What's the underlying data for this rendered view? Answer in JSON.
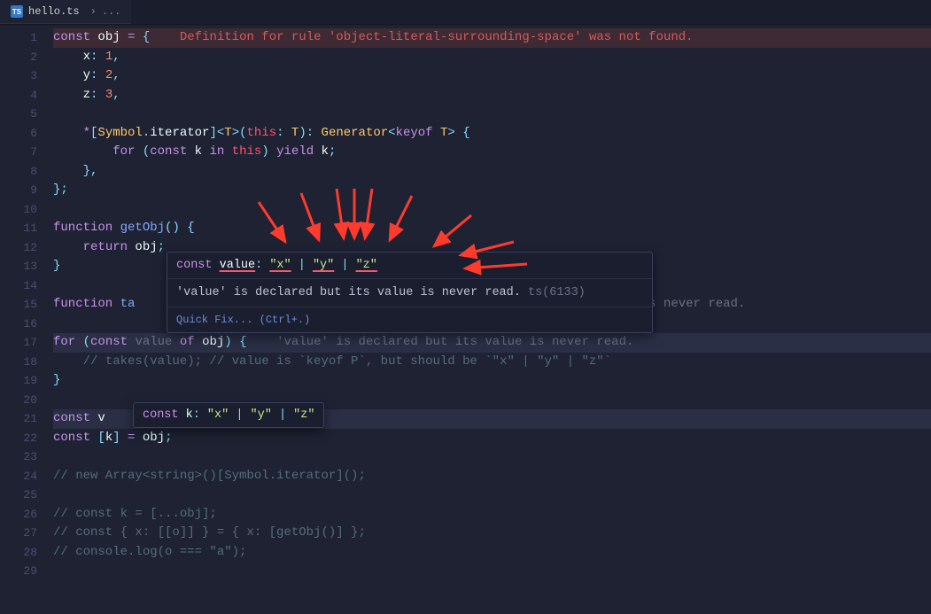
{
  "tab": {
    "label": "hello.ts",
    "icon": "TS",
    "breadcrumb_sep": "›",
    "breadcrumb_more": "..."
  },
  "lines": [
    {
      "n": 1,
      "segs": [
        {
          "t": "const ",
          "c": "kw-purple"
        },
        {
          "t": "obj",
          "c": "var"
        },
        {
          "t": " ",
          "c": ""
        },
        {
          "t": "=",
          "c": "kw-purple"
        },
        {
          "t": " ",
          "c": ""
        },
        {
          "t": "{",
          "c": "punct"
        },
        {
          "t": "    ",
          "c": ""
        },
        {
          "t": "Definition for rule 'object-literal-surrounding-space' was not found.",
          "c": "inline-err"
        }
      ],
      "hl": "err"
    },
    {
      "n": 2,
      "segs": [
        {
          "t": "    x",
          "c": "var"
        },
        {
          "t": ":",
          "c": "punct"
        },
        {
          "t": " ",
          "c": ""
        },
        {
          "t": "1",
          "c": "num"
        },
        {
          "t": ",",
          "c": "punct"
        }
      ]
    },
    {
      "n": 3,
      "segs": [
        {
          "t": "    y",
          "c": "var"
        },
        {
          "t": ":",
          "c": "punct"
        },
        {
          "t": " ",
          "c": ""
        },
        {
          "t": "2",
          "c": "num"
        },
        {
          "t": ",",
          "c": "punct"
        }
      ]
    },
    {
      "n": 4,
      "segs": [
        {
          "t": "    z",
          "c": "var"
        },
        {
          "t": ":",
          "c": "punct"
        },
        {
          "t": " ",
          "c": ""
        },
        {
          "t": "3",
          "c": "num"
        },
        {
          "t": ",",
          "c": "punct"
        }
      ]
    },
    {
      "n": 5,
      "segs": []
    },
    {
      "n": 6,
      "segs": [
        {
          "t": "    ",
          "c": ""
        },
        {
          "t": "*",
          "c": "kw-purple"
        },
        {
          "t": "[",
          "c": "punct"
        },
        {
          "t": "Symbol",
          "c": "fn-yellow"
        },
        {
          "t": ".",
          "c": "punct"
        },
        {
          "t": "iterator",
          "c": "var"
        },
        {
          "t": "]",
          "c": "punct"
        },
        {
          "t": "<",
          "c": "punct"
        },
        {
          "t": "T",
          "c": "fn-yellow"
        },
        {
          "t": ">",
          "c": "punct"
        },
        {
          "t": "(",
          "c": "punct"
        },
        {
          "t": "this",
          "c": "kw-red"
        },
        {
          "t": ":",
          "c": "punct"
        },
        {
          "t": " ",
          "c": ""
        },
        {
          "t": "T",
          "c": "fn-yellow"
        },
        {
          "t": ")",
          "c": "punct"
        },
        {
          "t": ":",
          "c": "punct"
        },
        {
          "t": " ",
          "c": ""
        },
        {
          "t": "Generator",
          "c": "fn-yellow"
        },
        {
          "t": "<",
          "c": "punct"
        },
        {
          "t": "keyof ",
          "c": "kw-purple"
        },
        {
          "t": "T",
          "c": "fn-yellow"
        },
        {
          "t": ">",
          "c": "punct"
        },
        {
          "t": " ",
          "c": ""
        },
        {
          "t": "{",
          "c": "punct"
        }
      ]
    },
    {
      "n": 7,
      "segs": [
        {
          "t": "        ",
          "c": ""
        },
        {
          "t": "for ",
          "c": "kw-purple"
        },
        {
          "t": "(",
          "c": "punct"
        },
        {
          "t": "const ",
          "c": "kw-purple"
        },
        {
          "t": "k",
          "c": "var"
        },
        {
          "t": " ",
          "c": ""
        },
        {
          "t": "in ",
          "c": "kw-purple"
        },
        {
          "t": "this",
          "c": "kw-red"
        },
        {
          "t": ")",
          "c": "punct"
        },
        {
          "t": " ",
          "c": ""
        },
        {
          "t": "yield ",
          "c": "kw-purple"
        },
        {
          "t": "k",
          "c": "var"
        },
        {
          "t": ";",
          "c": "punct"
        }
      ]
    },
    {
      "n": 8,
      "segs": [
        {
          "t": "    ",
          "c": ""
        },
        {
          "t": "},",
          "c": "punct"
        }
      ]
    },
    {
      "n": 9,
      "segs": [
        {
          "t": "};",
          "c": "punct"
        }
      ]
    },
    {
      "n": 10,
      "segs": []
    },
    {
      "n": 11,
      "segs": [
        {
          "t": "function ",
          "c": "kw-purple"
        },
        {
          "t": "getObj",
          "c": "fn-blue"
        },
        {
          "t": "()",
          "c": "punct"
        },
        {
          "t": " ",
          "c": ""
        },
        {
          "t": "{",
          "c": "punct"
        }
      ]
    },
    {
      "n": 12,
      "segs": [
        {
          "t": "    ",
          "c": ""
        },
        {
          "t": "return ",
          "c": "kw-purple"
        },
        {
          "t": "obj",
          "c": "var"
        },
        {
          "t": ";",
          "c": "punct"
        }
      ]
    },
    {
      "n": 13,
      "segs": [
        {
          "t": "}",
          "c": "punct"
        }
      ]
    },
    {
      "n": 14,
      "segs": []
    },
    {
      "n": 15,
      "segs": [
        {
          "t": "function ",
          "c": "kw-purple"
        },
        {
          "t": "ta",
          "c": "fn-blue"
        },
        {
          "t": "                                                                    ",
          "c": ""
        },
        {
          "t": "is never read.",
          "c": "faded"
        }
      ]
    },
    {
      "n": 16,
      "segs": []
    },
    {
      "n": 17,
      "segs": [
        {
          "t": "for ",
          "c": "kw-purple"
        },
        {
          "t": "(",
          "c": "punct"
        },
        {
          "t": "const ",
          "c": "kw-purple"
        },
        {
          "t": "value",
          "c": "faded"
        },
        {
          "t": " ",
          "c": ""
        },
        {
          "t": "of ",
          "c": "kw-purple"
        },
        {
          "t": "obj",
          "c": "var"
        },
        {
          "t": ")",
          "c": "punct"
        },
        {
          "t": " ",
          "c": ""
        },
        {
          "t": "{",
          "c": "punct"
        },
        {
          "t": "    ",
          "c": ""
        },
        {
          "t": "'value' is declared but its value is never read.",
          "c": "faded"
        }
      ],
      "hl": "hl"
    },
    {
      "n": 18,
      "segs": [
        {
          "t": "    ",
          "c": ""
        },
        {
          "t": "// takes(value); // value is `keyof P`, but should be `\"x\" | \"y\" | \"z\"`",
          "c": "comment"
        }
      ]
    },
    {
      "n": 19,
      "segs": [
        {
          "t": "}",
          "c": "punct"
        }
      ]
    },
    {
      "n": 20,
      "segs": []
    },
    {
      "n": 21,
      "segs": [
        {
          "t": "const ",
          "c": "kw-purple"
        },
        {
          "t": "v",
          "c": "var"
        }
      ],
      "hl": "hl"
    },
    {
      "n": 22,
      "segs": [
        {
          "t": "const ",
          "c": "kw-purple"
        },
        {
          "t": "[",
          "c": "punct"
        },
        {
          "t": "k",
          "c": "var"
        },
        {
          "t": "]",
          "c": "punct"
        },
        {
          "t": " ",
          "c": ""
        },
        {
          "t": "=",
          "c": "kw-purple"
        },
        {
          "t": " ",
          "c": ""
        },
        {
          "t": "obj",
          "c": "var"
        },
        {
          "t": ";",
          "c": "punct"
        }
      ]
    },
    {
      "n": 23,
      "segs": []
    },
    {
      "n": 24,
      "segs": [
        {
          "t": "// new Array<string>()[Symbol.iterator]();",
          "c": "comment"
        }
      ]
    },
    {
      "n": 25,
      "segs": []
    },
    {
      "n": 26,
      "segs": [
        {
          "t": "// const k = [...obj];",
          "c": "comment"
        }
      ]
    },
    {
      "n": 27,
      "segs": [
        {
          "t": "// const { x: [[o]] } = { x: [getObj()] };",
          "c": "comment"
        }
      ]
    },
    {
      "n": 28,
      "segs": [
        {
          "t": "// console.log(o === \"a\");",
          "c": "comment"
        }
      ]
    },
    {
      "n": 29,
      "segs": []
    }
  ],
  "hover1": {
    "sig_const": "const ",
    "sig_name": "value",
    "sig_colon": ": ",
    "sig_xa": "\"x\"",
    "sig_pipe1": " | ",
    "sig_ya": "\"y\"",
    "sig_pipe2": " | ",
    "sig_za": "\"z\"",
    "diag": "'value' is declared but its value is never read. ",
    "diag_code": "ts(6133)",
    "quickfix": "Quick Fix... (Ctrl+.)"
  },
  "hover2": {
    "sig_const": "const ",
    "sig_name": "k",
    "sig_colon": ": ",
    "sig_xa": "\"x\"",
    "sig_pipe1": " | ",
    "sig_ya": "\"y\"",
    "sig_pipe2": " | ",
    "sig_za": "\"z\""
  },
  "arrow_color": "#ff3b2e"
}
